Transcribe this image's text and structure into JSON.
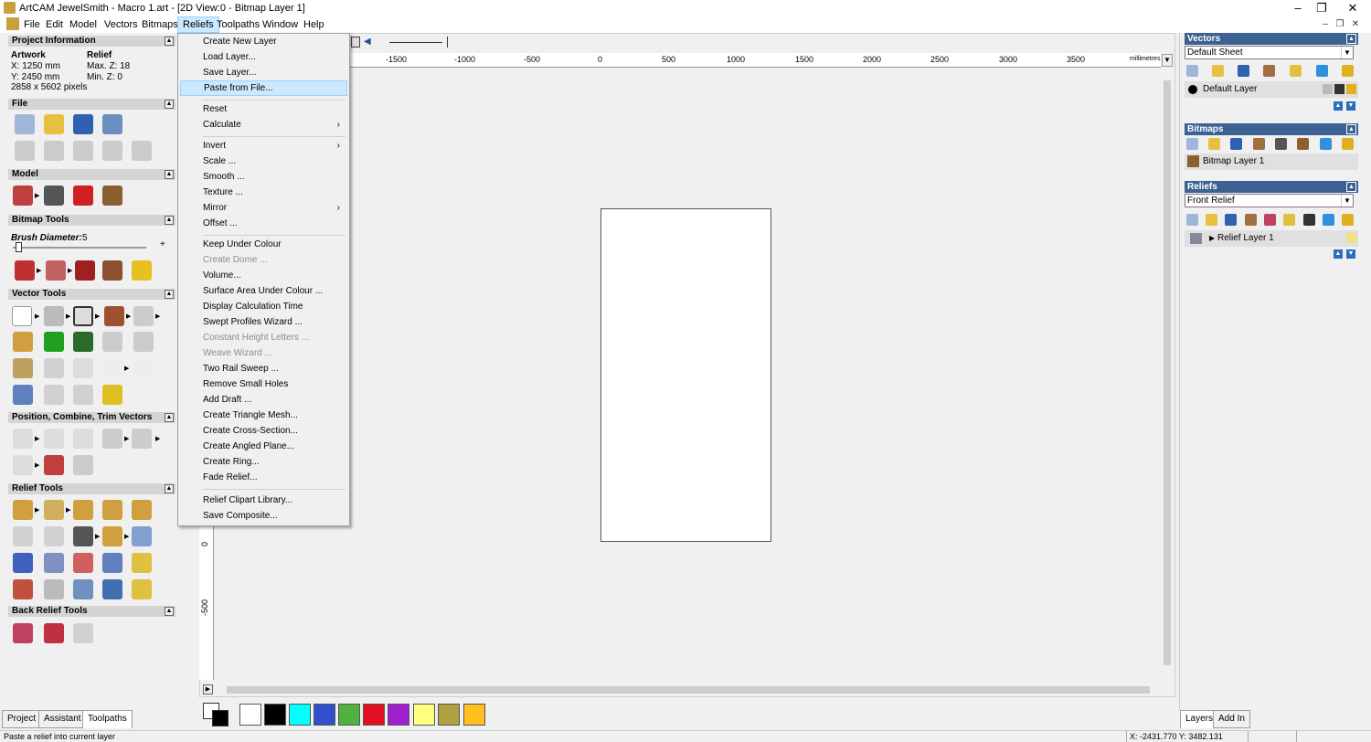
{
  "titlebar": {
    "title": "ArtCAM JewelSmith - Macro 1.art - [2D View:0 - Bitmap Layer 1]"
  },
  "menu": [
    "File",
    "Edit",
    "Model",
    "Vectors",
    "Bitmaps",
    "Reliefs",
    "Toolpaths",
    "Window",
    "Help"
  ],
  "left": {
    "project_info": "Project Information",
    "artwork": "Artwork",
    "relief": "Relief",
    "x": "X: 1250 mm",
    "y": "Y: 2450 mm",
    "pixels": "2858 x 5602 pixels",
    "maxz": "Max. Z: 18",
    "minz": "Min. Z: 0",
    "file": "File",
    "model": "Model",
    "bitmap_tools": "Bitmap Tools",
    "brush_label": "Brush Diameter:",
    "brush_value": "5",
    "vector_tools": "Vector Tools",
    "position_tools": "Position, Combine, Trim Vectors",
    "relief_tools": "Relief Tools",
    "back_relief_tools": "Back Relief Tools"
  },
  "reliefs_menu": {
    "items": [
      {
        "label": "Create New Layer"
      },
      {
        "label": "Load Layer..."
      },
      {
        "label": "Save Layer..."
      },
      {
        "label": "Paste from File..."
      },
      {
        "label": "Reset"
      },
      {
        "label": "Calculate"
      },
      {
        "label": "Invert"
      },
      {
        "label": "Scale ..."
      },
      {
        "label": "Smooth ..."
      },
      {
        "label": "Texture ..."
      },
      {
        "label": "Mirror"
      },
      {
        "label": "Offset ..."
      },
      {
        "label": "Keep Under Colour"
      },
      {
        "label": "Create Dome ..."
      },
      {
        "label": "Volume..."
      },
      {
        "label": "Surface Area Under Colour ..."
      },
      {
        "label": "Display Calculation Time"
      },
      {
        "label": "Swept Profiles Wizard ..."
      },
      {
        "label": "Constant Height Letters ..."
      },
      {
        "label": "Weave Wizard ..."
      },
      {
        "label": "Two Rail Sweep ..."
      },
      {
        "label": "Remove Small Holes"
      },
      {
        "label": "Add Draft ..."
      },
      {
        "label": "Create Triangle Mesh..."
      },
      {
        "label": "Create Cross-Section..."
      },
      {
        "label": "Create Angled Plane..."
      },
      {
        "label": "Create Ring..."
      },
      {
        "label": "Fade Relief..."
      },
      {
        "label": "Relief Clipart Library..."
      },
      {
        "label": "Save Composite..."
      }
    ]
  },
  "ruler": {
    "top": [
      "-1500",
      "-1000",
      "-500",
      "0",
      "500",
      "1000",
      "1500",
      "2000",
      "2500",
      "3000",
      "3500"
    ],
    "unit": "millimetres",
    "left": [
      "0",
      "-500"
    ]
  },
  "right": {
    "vectors": "Vectors",
    "vectors_sheet": "Default Sheet",
    "default_layer": "Default Layer",
    "bitmaps": "Bitmaps",
    "bitmap_layer": "Bitmap Layer 1",
    "reliefs": "Reliefs",
    "reliefs_sel": "Front Relief",
    "relief_layer": "Relief Layer 1"
  },
  "tabs": {
    "project": "Project",
    "assistant": "Assistant",
    "toolpaths": "Toolpaths",
    "layers": "Layers",
    "addin": "Add In"
  },
  "palette": [
    "#ffffff",
    "#000000",
    "#00ffff",
    "#3050d0",
    "#50b040",
    "#e01020",
    "#a020d0",
    "#ffff80",
    "#b0a040",
    "#ffc020"
  ],
  "status": {
    "message": "Paste a relief into current layer",
    "coords": "X: -2431.770  Y: 3482.131"
  }
}
